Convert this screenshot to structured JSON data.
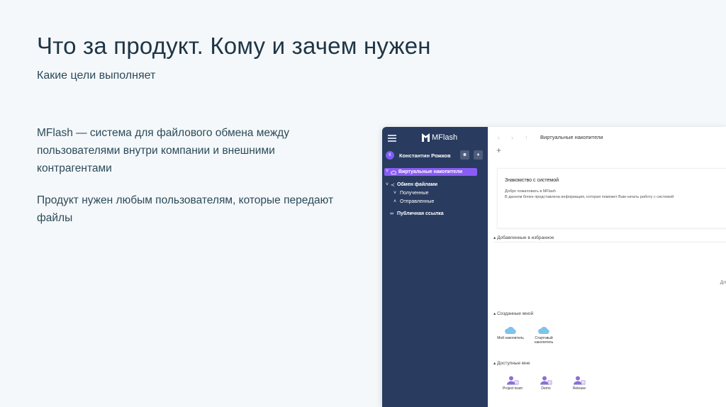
{
  "slide": {
    "title": "Что за продукт. Кому и зачем нужен",
    "subtitle": "Какие цели выполняет",
    "paragraph1": "MFlash — система для файлового обмена между пользователями внутри компании и внешними контрагентами",
    "paragraph2": "Продукт нужен любым пользователям, которые передают файлы"
  },
  "app": {
    "logo": "MFlash",
    "user_initial": "К",
    "user_name": "Константин Рожков",
    "sidebar": {
      "virtual_drives": "Виртуальные накопители",
      "file_exchange": "Обмен файлами",
      "received": "Полученные",
      "sent": "Отправленные",
      "public_link": "Публичная ссылка"
    },
    "breadcrumb": "Виртуальные накопители",
    "welcome": {
      "title": "Знакомство с системой",
      "line1": "Добро пожаловать в MFlash",
      "line2": "В данном блоке представлена информация, которая поможет Вам начать работу с системой"
    },
    "sections": {
      "favorites": "Добавленные в избранное",
      "created": "Созданные мной",
      "available": "Доступные мне"
    },
    "cut_off_text": "Дл",
    "created_drives": [
      {
        "label": "Мой накопитель"
      },
      {
        "label": "Стартовый накопитель"
      }
    ],
    "available_groups": [
      {
        "label": "Project team",
        "badge": "1"
      },
      {
        "label": "Demo",
        "badge": "3"
      },
      {
        "label": "Release",
        "badge": "1"
      }
    ],
    "colors": {
      "sidebar_bg": "#293b5f",
      "active_item": "#8a5cf6",
      "cloud": "#7ec3ec",
      "person": "#8b6fd6"
    }
  }
}
